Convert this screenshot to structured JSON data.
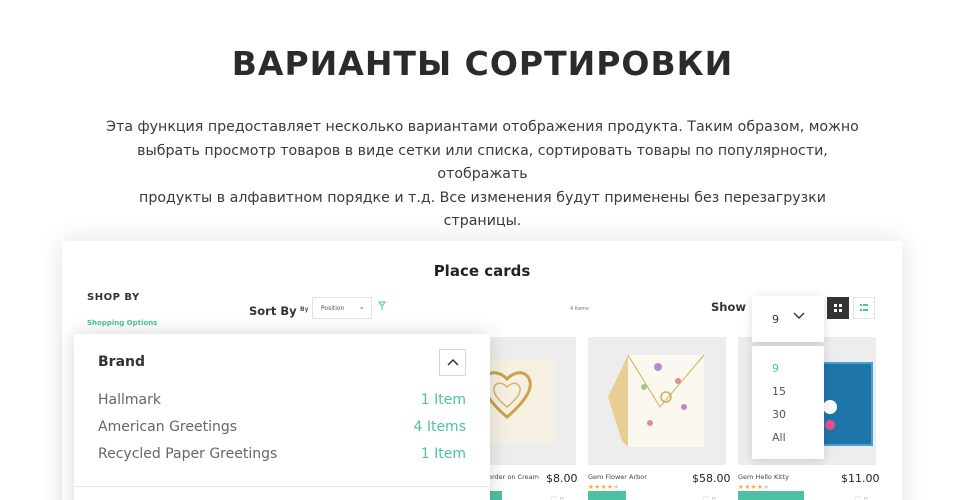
{
  "hero": {
    "title": "ВАРИАНТЫ СОРТИРОВКИ",
    "desc_line1": "Эта функция предоставляет несколько вариантами отображения продукта. Таким образом, можно",
    "desc_line2": "выбрать просмотр товаров в виде сетки или списка, сортировать товары по популярности, отображать",
    "desc_line3": "продукты в алфавитном порядке и т.д. Все изменения будут применены без перезагрузки страницы."
  },
  "panel": {
    "title": "Place cards",
    "shop_by": "SHOP BY",
    "shopping_options": "Shopping Options",
    "sort_by_label": "Sort By",
    "sort_by_small": "By",
    "sort_value": "Position",
    "items_count": "4 Items",
    "show_label": "Show"
  },
  "show": {
    "value": "9",
    "options": [
      "9",
      "15",
      "30",
      "All"
    ],
    "active": "9"
  },
  "brand": {
    "title": "Brand",
    "items": [
      {
        "name": "Hallmark",
        "count": "1 Item"
      },
      {
        "name": "American Greetings",
        "count": "4 Items"
      },
      {
        "name": "Recycled Paper Greetings",
        "count": "1 Item"
      }
    ]
  },
  "products": [
    {
      "name": "order on Cream",
      "price": "$8.00"
    },
    {
      "name": "Gem Flower Arbor",
      "price": "$58.00"
    },
    {
      "name": "Gem Hello Kitty",
      "price": "$11.00"
    }
  ],
  "colors": {
    "accent": "#4cc1a4",
    "stars": "#f2b01e",
    "text": "#333333"
  }
}
